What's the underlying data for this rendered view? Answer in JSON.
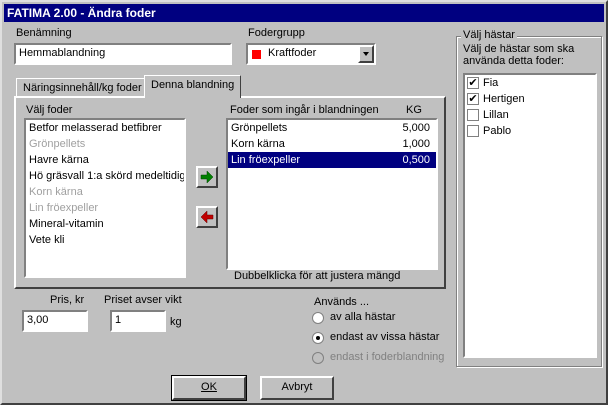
{
  "title": "FATIMA 2.00 - Ändra foder",
  "benamning": {
    "label": "Benämning",
    "value": "Hemmablandning"
  },
  "fodergrupp": {
    "label": "Fodergrupp",
    "value": "Kraftfoder",
    "color": "#ff0000"
  },
  "tabs": [
    {
      "label": "Näringsinnehåll/kg foder"
    },
    {
      "label": "Denna blandning"
    }
  ],
  "valj_foder": {
    "label": "Välj foder",
    "items": [
      {
        "label": "Betfor melasserad betfibrer",
        "disabled": false
      },
      {
        "label": "Grönpellets",
        "disabled": true
      },
      {
        "label": "Havre  kärna",
        "disabled": false
      },
      {
        "label": "Hö gräsvall 1:a skörd medeltidig :",
        "disabled": false
      },
      {
        "label": "Korn kärna",
        "disabled": true
      },
      {
        "label": "Lin fröexpeller",
        "disabled": true
      },
      {
        "label": "Mineral-vitamin",
        "disabled": false
      },
      {
        "label": "Vete kli",
        "disabled": false
      }
    ]
  },
  "blandning": {
    "header_label": "Foder som ingår i blandningen",
    "header_kg": "KG",
    "items": [
      {
        "label": "Grönpellets",
        "kg": "5,000",
        "selected": false
      },
      {
        "label": "Korn kärna",
        "kg": "1,000",
        "selected": false
      },
      {
        "label": "Lin fröexpeller",
        "kg": "0,500",
        "selected": true
      }
    ],
    "hint": "Dubbelklicka för att justera mängd"
  },
  "arrows": {
    "add_icon": "arrow-right-icon",
    "remove_icon": "arrow-left-icon",
    "add_color": "#008000",
    "remove_color": "#c00000"
  },
  "pris": {
    "label": "Pris, kr",
    "value": "3,00"
  },
  "vikt": {
    "label": "Priset avser vikt",
    "value": "1",
    "unit": "kg"
  },
  "anvands": {
    "label": "Används ...",
    "options": [
      {
        "label": "av alla hästar",
        "checked": false,
        "disabled": false
      },
      {
        "label": "endast av vissa hästar",
        "checked": true,
        "disabled": false
      },
      {
        "label": "endast i foderblandning",
        "checked": false,
        "disabled": true
      }
    ]
  },
  "valj_hastar": {
    "title": "Välj hästar",
    "desc": "Välj de hästar som ska använda detta foder:",
    "horses": [
      {
        "name": "Fia",
        "checked": true
      },
      {
        "name": "Hertigen",
        "checked": true
      },
      {
        "name": "Lillan",
        "checked": false
      },
      {
        "name": "Pablo",
        "checked": false
      }
    ]
  },
  "buttons": {
    "ok": "OK",
    "cancel": "Avbryt"
  }
}
